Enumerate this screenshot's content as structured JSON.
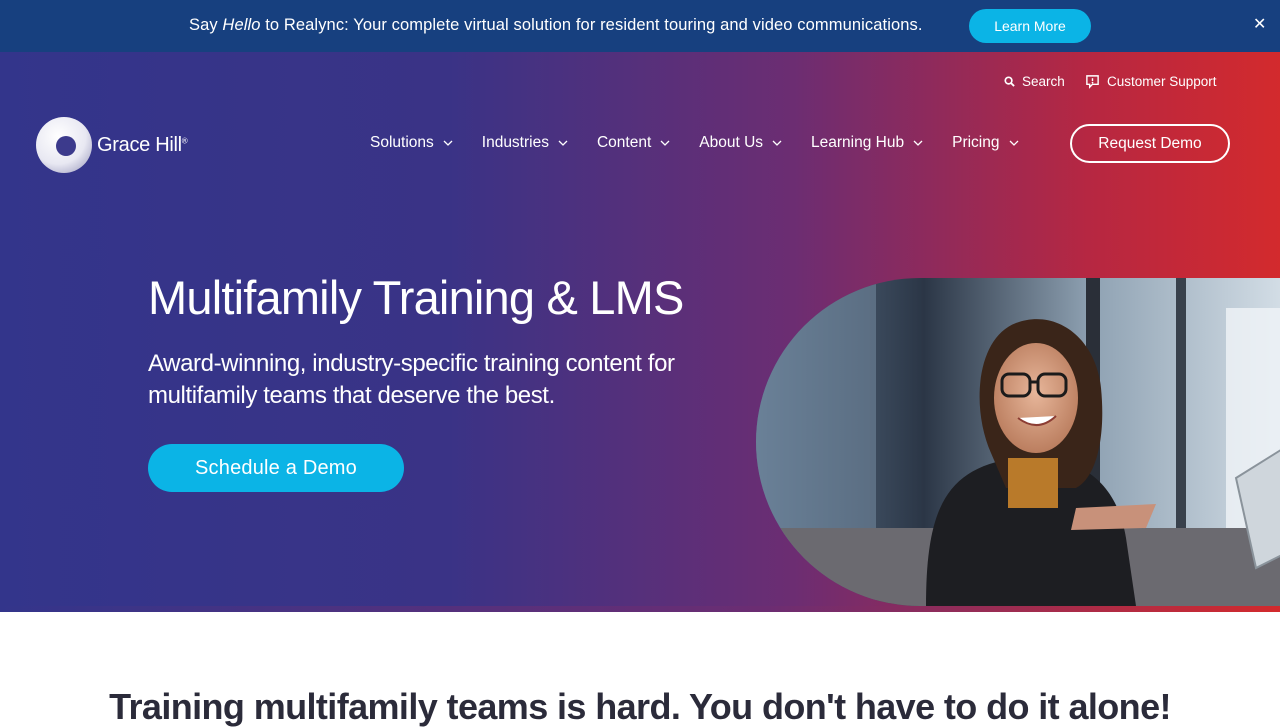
{
  "announcement": {
    "prefix": "Say ",
    "emphasis": "Hello",
    "suffix": " to Realync: Your complete virtual solution for resident touring and video communications.",
    "cta_label": "Learn More",
    "close_label": "✕"
  },
  "utility_nav": {
    "search_label": "Search",
    "support_label": "Customer Support"
  },
  "brand": {
    "name": "Grace Hill",
    "mark": "®"
  },
  "main_nav": {
    "items": [
      {
        "label": "Solutions"
      },
      {
        "label": "Industries"
      },
      {
        "label": "Content"
      },
      {
        "label": "About Us"
      },
      {
        "label": "Learning Hub"
      },
      {
        "label": "Pricing"
      }
    ],
    "cta_label": "Request Demo"
  },
  "hero": {
    "title": "Multifamily Training & LMS",
    "subtitle": "Award-winning, industry-specific training content for multifamily teams that deserve the best.",
    "cta_label": "Schedule a Demo"
  },
  "intro": {
    "heading": "Training multifamily teams is hard. You don't have to do it alone!"
  },
  "colors": {
    "announcement_bg": "#17407f",
    "accent": "#0bb4e6",
    "hero_gradient_start": "#33358b",
    "hero_gradient_end": "#d32a2d"
  }
}
